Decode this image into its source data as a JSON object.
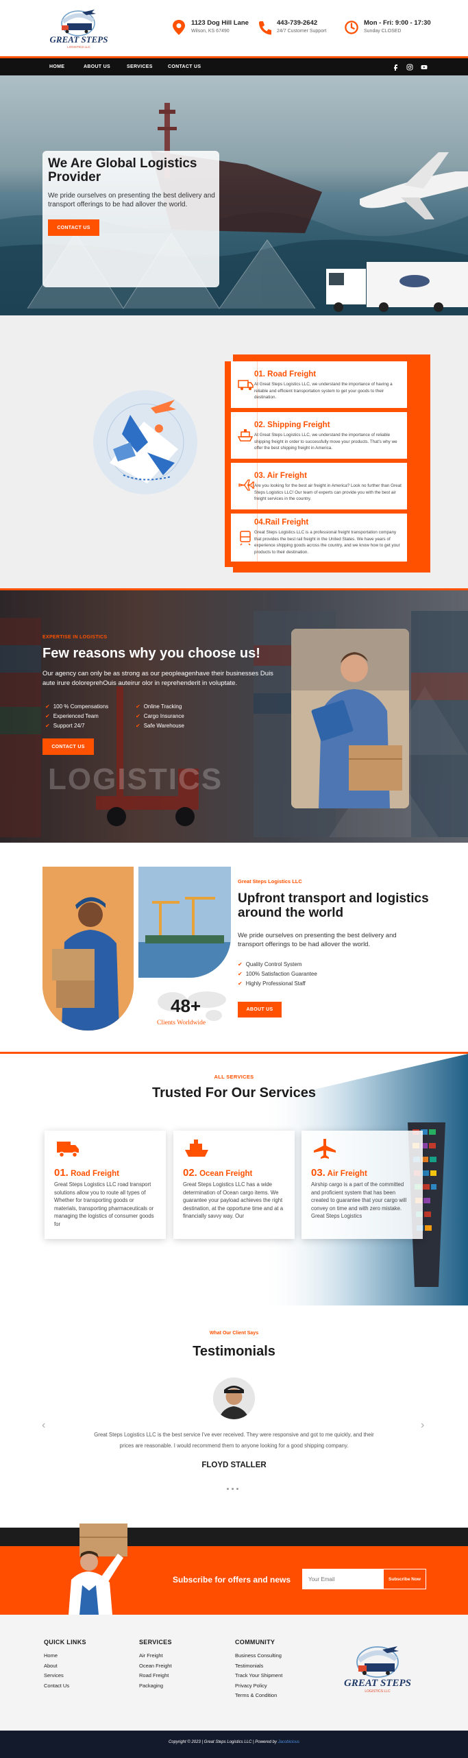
{
  "header": {
    "brand": {
      "name": "GREAT STEPS",
      "tagline": "LOGISTICS LLC"
    },
    "address": {
      "line1": "1123 Dog Hill Lane",
      "line2": "Wilson, KS 67490"
    },
    "phone": {
      "line1": "443-739-2642",
      "line2": "24/7 Customer Support"
    },
    "hours": {
      "line1": "Mon - Fri: 9:00 - 17:30",
      "line2": "Sunday CLOSED"
    }
  },
  "nav": {
    "items": [
      "HOME",
      "ABOUT US",
      "SERVICES",
      "CONTACT US"
    ],
    "social": [
      "facebook-icon",
      "instagram-icon",
      "youtube-icon"
    ]
  },
  "hero": {
    "title": "We Are Global Logistics Provider",
    "text": "We pride ourselves on presenting the best delivery and transport offerings to be had allover the world.",
    "button": "CONTACT US"
  },
  "services_list": [
    {
      "title": "01. Road Freight",
      "text": "At Great Steps Logistics LLC, we understand the importance of having a reliable and efficient transportation system to get your goods to their destination."
    },
    {
      "title": "02. Shipping Freight",
      "text": "At Great Steps Logistics LLC, we understand the importance of reliable shipping freight in order to successfully move your products. That's why we offer the best shipping freight in America."
    },
    {
      "title": "03. Air Freight",
      "text": "Are you looking for the best air freight in America? Look no further than Great Steps Logistics LLC! Our team of experts can provide you with the best air freight services in the country."
    },
    {
      "title": "04.Rail Freight",
      "text": "Great Steps Logistics LLC is a professional freight transportation company that provides the best rail freight in the United States. We have years of experience shipping goods across the country, and we know how to get your products to their destination."
    }
  ],
  "reasons": {
    "eyebrow": "EXPERTISE IN LOGISTICS",
    "title": "Few reasons why you choose us!",
    "text": "Our agency can only be as strong as our peopleagenhave their businesses Duis aute irure doloreprehOuis auteirur olor in reprehenderit in voluptate.",
    "checks": [
      "100 % Compensations",
      "Experienced Team",
      "Support 24/7",
      "Online Tracking",
      "Cargo Insurance",
      "Safe Warehouse"
    ],
    "button": "CONTACT US",
    "watermark": "LOGISTICS"
  },
  "about": {
    "eyebrow": "Great Steps Logistics LLC",
    "title": "Upfront transport and logistics around the world",
    "text": "We pride ourselves on presenting the best delivery and transport offerings to be had allover the world.",
    "checks": [
      "Quality Control System",
      "100% Satisfaction Guarantee",
      "Highly Professional Staff"
    ],
    "button": "ABOUT US",
    "stat_value": "48+",
    "stat_label": "Clients Worldwide"
  },
  "trusted": {
    "eyebrow": "ALL SERVICES",
    "title": "Trusted For Our Services",
    "cards": [
      {
        "num": "01.",
        "title": "Road Freight",
        "text": "Great Steps Logistics LLC road transport solutions allow you to route all types of Whether for transporting goods or materials, transporting pharmaceuticals or managing the logistics of consumer goods for"
      },
      {
        "num": "02.",
        "title": "Ocean Freight",
        "text": "Great Steps Logistics LLC has a wide determination of Ocean cargo items. We guarantee your payload achieves the right destination, at the opportune time and at a financially savvy way. Our"
      },
      {
        "num": "03.",
        "title": "Air Freight",
        "text": "Airship cargo is a part of the committed and proficient system that has been created to guarantee that your cargo will convey on time and with zero mistake. Great Steps Logistics"
      }
    ]
  },
  "testimonials": {
    "eyebrow": "What Our Client Says",
    "title": "Testimonials",
    "quote": "Great Steps Logistics LLC is the best service I've ever received. They were responsive and got to me quickly, and their prices are reasonable. I would recommend them to anyone looking for a good shipping company.",
    "name": "FLOYD STALLER",
    "prev": "‹",
    "next": "›"
  },
  "subscribe": {
    "text": "Subscribe for offers and news",
    "placeholder": "Your Email",
    "button": "Subscribe Now"
  },
  "footer": {
    "quick_links": {
      "title": "QUICK LINKS",
      "items": [
        "Home",
        "About",
        "Services",
        "Contact Us"
      ]
    },
    "services": {
      "title": "SERVICES",
      "items": [
        "Air Freight",
        "Ocean Freight",
        "Road Freight",
        "Packaging"
      ]
    },
    "community": {
      "title": "COMMUNITY",
      "items": [
        "Business Consulting",
        "Testimonials",
        "Track Your Shipment",
        "Privacy Policy",
        "Terms & Condition"
      ]
    },
    "copyright_prefix": "Copyright © 2023 | Great Steps Logistics LLC | Powered by ",
    "copyright_link": "Jacobicious"
  },
  "colors": {
    "accent": "#ff5100",
    "dark": "#111111",
    "footer_bar": "#131a2b"
  }
}
